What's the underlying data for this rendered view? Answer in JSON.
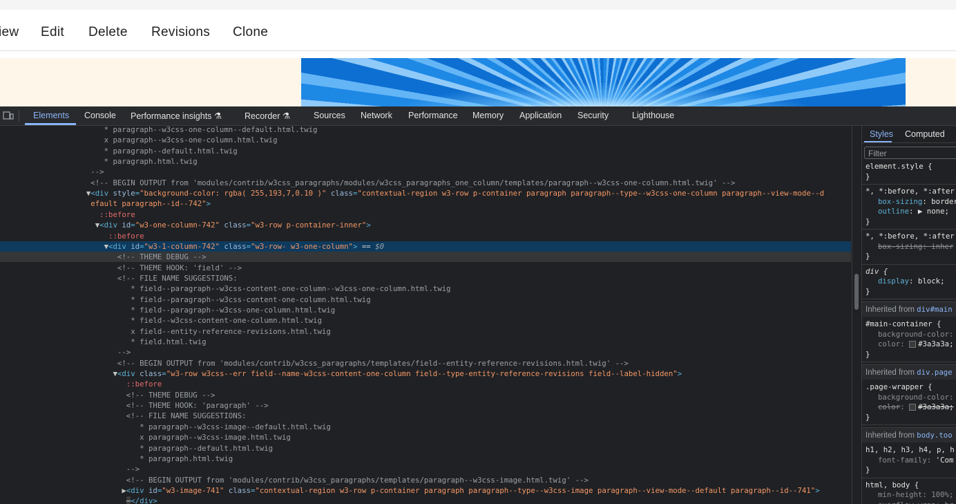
{
  "page_tabs": [
    "iew",
    "Edit",
    "Delete",
    "Revisions",
    "Clone"
  ],
  "devtools": {
    "tabs": [
      "Elements",
      "Console",
      "Performance insights",
      "Recorder",
      "Sources",
      "Network",
      "Performance",
      "Memory",
      "Application",
      "Security",
      "Lighthouse"
    ],
    "active_tab": "Elements",
    "experimental_icon": "flask-icon"
  },
  "dom_lines": [
    {
      "indent": 0,
      "html": "<span class='t-cmt'>      * paragraph--w3css-one-column--default.html.twig</span>"
    },
    {
      "indent": 0,
      "html": "<span class='t-cmt'>      x paragraph--w3css-one-column.html.twig</span>"
    },
    {
      "indent": 0,
      "html": "<span class='t-cmt'>      * paragraph--default.html.twig</span>"
    },
    {
      "indent": 0,
      "html": "<span class='t-cmt'>      * paragraph.html.twig</span>"
    },
    {
      "indent": 0,
      "html": "<span class='t-cmt'>   --></span>"
    },
    {
      "indent": 0,
      "html": "<span class='t-cmt'>   &lt;!-- BEGIN OUTPUT from 'modules/contrib/w3css_paragraphs/modules/w3css_paragraphs_one_column/templates/paragraph--w3css-one-column.html.twig' --></span>"
    },
    {
      "indent": 0,
      "html": "<span class='tri'>  ▼</span><span class='t-tag'>&lt;div </span><span class='t-attr'>style</span><span class='t-tag'>=</span><span class='t-val'>\"background-color: rgba( 255,193,7,0.10 )\"</span><span class='t-tag'> </span><span class='t-attr'>class</span><span class='t-tag'>=</span><span class='t-val'>\"contextual-region w3-row p-container paragraph paragraph--type--w3css-one-column paragraph--view-mode--d</span>"
    },
    {
      "indent": 0,
      "html": "<span class='t-val'>   efault paragraph--id--742\"</span><span class='t-tag'>></span>"
    },
    {
      "indent": 0,
      "html": "<span class='t-pseudo'>     ::before</span>"
    },
    {
      "indent": 0,
      "html": "<span class='tri'>    ▼</span><span class='t-tag'>&lt;div </span><span class='t-attr'>id</span><span class='t-tag'>=</span><span class='t-val'>\"w3-one-column-742\"</span><span class='t-tag'> </span><span class='t-attr'>class</span><span class='t-tag'>=</span><span class='t-val'>\"w3-row p-container-inner\"</span><span class='t-tag'>></span>"
    },
    {
      "indent": 0,
      "html": "<span class='t-pseudo'>       ::before</span>"
    },
    {
      "indent": 0,
      "sel": true,
      "html": "<span class='tri'>      ▼</span><span class='t-tag'>&lt;div </span><span class='t-attr'>id</span><span class='t-tag'>=</span><span class='t-val'>\"w3-1-column-742\"</span><span class='t-tag'> </span><span class='t-attr'>class</span><span class='t-tag'>=</span><span class='t-val'>\"w3-row- w3-one-column\"</span><span class='t-tag'>></span><span class='t-txt'> == </span><span class='t-dollar'>$0</span>"
    },
    {
      "indent": 0,
      "hov": true,
      "html": "<span class='t-cmt'>         &lt;!-- THEME DEBUG --></span>"
    },
    {
      "indent": 0,
      "html": "<span class='t-cmt'>         &lt;!-- THEME HOOK: 'field' --></span>"
    },
    {
      "indent": 0,
      "html": "<span class='t-cmt'>         &lt;!-- FILE NAME SUGGESTIONS:</span>"
    },
    {
      "indent": 0,
      "html": "<span class='t-cmt'>            * field--paragraph--w3css-content-one-column--w3css-one-column.html.twig</span>"
    },
    {
      "indent": 0,
      "html": "<span class='t-cmt'>            * field--paragraph--w3css-content-one-column.html.twig</span>"
    },
    {
      "indent": 0,
      "html": "<span class='t-cmt'>            * field--paragraph--w3css-one-column.html.twig</span>"
    },
    {
      "indent": 0,
      "html": "<span class='t-cmt'>            * field--w3css-content-one-column.html.twig</span>"
    },
    {
      "indent": 0,
      "html": "<span class='t-cmt'>            x field--entity-reference-revisions.html.twig</span>"
    },
    {
      "indent": 0,
      "html": "<span class='t-cmt'>            * field.html.twig</span>"
    },
    {
      "indent": 0,
      "html": "<span class='t-cmt'>         --></span>"
    },
    {
      "indent": 0,
      "html": "<span class='t-cmt'>         &lt;!-- BEGIN OUTPUT from 'modules/contrib/w3css_paragraphs/templates/field--entity-reference-revisions.html.twig' --></span>"
    },
    {
      "indent": 0,
      "html": "<span class='tri'>        ▼</span><span class='t-tag'>&lt;div </span><span class='t-attr'>class</span><span class='t-tag'>=</span><span class='t-val'>\"w3-row w3css--err field--name-w3css-content-one-column field--type-entity-reference-revisions field--label-hidden\"</span><span class='t-tag'>></span>"
    },
    {
      "indent": 0,
      "html": "<span class='t-pseudo'>           ::before</span>"
    },
    {
      "indent": 0,
      "html": "<span class='t-cmt'>           &lt;!-- THEME DEBUG --></span>"
    },
    {
      "indent": 0,
      "html": "<span class='t-cmt'>           &lt;!-- THEME HOOK: 'paragraph' --></span>"
    },
    {
      "indent": 0,
      "html": "<span class='t-cmt'>           &lt;!-- FILE NAME SUGGESTIONS:</span>"
    },
    {
      "indent": 0,
      "html": "<span class='t-cmt'>              * paragraph--w3css-image--default.html.twig</span>"
    },
    {
      "indent": 0,
      "html": "<span class='t-cmt'>              x paragraph--w3css-image.html.twig</span>"
    },
    {
      "indent": 0,
      "html": "<span class='t-cmt'>              * paragraph--default.html.twig</span>"
    },
    {
      "indent": 0,
      "html": "<span class='t-cmt'>              * paragraph.html.twig</span>"
    },
    {
      "indent": 0,
      "html": "<span class='t-cmt'>           --></span>"
    },
    {
      "indent": 0,
      "html": "<span class='t-cmt'>           &lt;!-- BEGIN OUTPUT from 'modules/contrib/w3css_paragraphs/templates/paragraph--w3css-image.html.twig' --></span>"
    },
    {
      "indent": 0,
      "html": "<span class='tri'>          ▶</span><span class='t-tag'>&lt;div </span><span class='t-attr'>id</span><span class='t-tag'>=</span><span class='t-val'>\"w3-image-741\"</span><span class='t-tag'> </span><span class='t-attr'>class</span><span class='t-tag'>=</span><span class='t-val'>\"contextual-region w3-row p-container paragraph paragraph--type--w3css-image paragraph--view-mode--default paragraph--id--741\"</span><span class='t-tag'>></span>"
    },
    {
      "indent": 0,
      "html": "<span class='t-txt'>           </span><span class='t-tag' style='background:#3c3c3c;border-radius:2px;color:#ccc'>⋯</span><span class='t-tag'>&lt;/div></span>"
    }
  ],
  "styles": {
    "tabs": [
      "Styles",
      "Computed"
    ],
    "filter_placeholder": "Filter",
    "rules": [
      {
        "selector": "element.style {",
        "props": [],
        "close": "}"
      },
      {
        "selector": "*, *:before, *:after",
        "props": [
          [
            "box-sizing",
            "border"
          ],
          [
            "outline",
            "▶ none;"
          ]
        ],
        "close": "}"
      },
      {
        "selector": "*, *:before, *:after",
        "props": [
          [
            "box-sizing",
            "inher"
          ]
        ],
        "close": "}",
        "struck": true
      },
      {
        "selector": "div {",
        "props": [
          [
            "display",
            "block;"
          ]
        ],
        "close": "}",
        "italic": true
      }
    ],
    "inherited": [
      {
        "label": "Inherited from",
        "link": "div#main",
        "selector": "#main-container {",
        "props": [
          [
            "background-color",
            ""
          ],
          [
            "color",
            "#3a3a3a;"
          ]
        ]
      },
      {
        "label": "Inherited from",
        "link": "div.page",
        "selector": ".page-wrapper {",
        "props": [
          [
            "background-color",
            ""
          ],
          [
            "color",
            "#3a3a3a;"
          ]
        ]
      },
      {
        "label": "Inherited from",
        "link": "body.too",
        "selector": "h1, h2, h3, h4, p, h",
        "props": [
          [
            "font-family",
            "'Com"
          ]
        ]
      }
    ],
    "last_rule": {
      "selector": "html, body {",
      "props": [
        [
          "min-height",
          "100%;"
        ],
        [
          "overflow-wrap",
          "br"
        ]
      ]
    }
  }
}
